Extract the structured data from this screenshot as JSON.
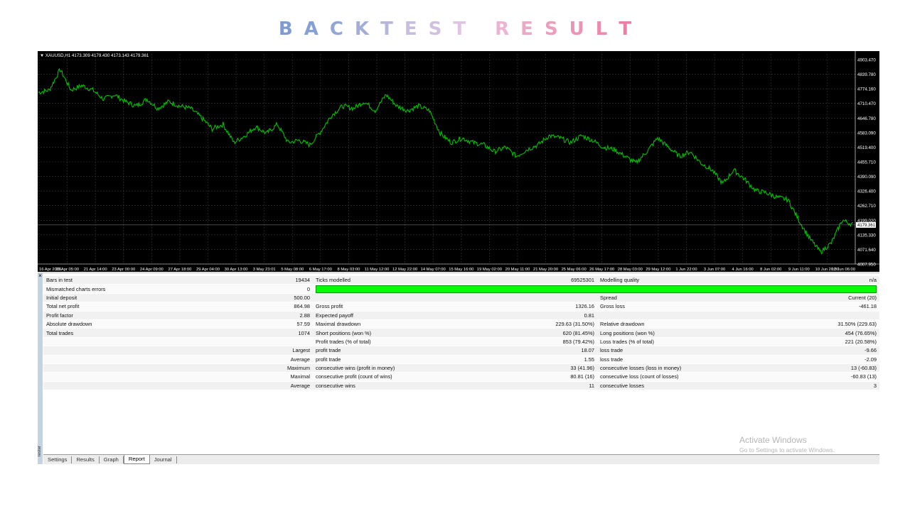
{
  "banner": {
    "letters": [
      {
        "ch": "B",
        "color": "#7f9bd1"
      },
      {
        "ch": "A",
        "color": "#86a0d3"
      },
      {
        "ch": "C",
        "color": "#93a7d6"
      },
      {
        "ch": "K",
        "color": "#a0aed9"
      },
      {
        "ch": "T",
        "color": "#b4b6dc"
      },
      {
        "ch": "E",
        "color": "#c6bddf"
      },
      {
        "ch": "S",
        "color": "#d2c0e0"
      },
      {
        "ch": "T",
        "color": "#e0c4e1"
      },
      {
        "ch": " ",
        "color": "#ffffff"
      },
      {
        "ch": "R",
        "color": "#eab4d2"
      },
      {
        "ch": "E",
        "color": "#eba9c7"
      },
      {
        "ch": "S",
        "color": "#ec9ebd"
      },
      {
        "ch": "U",
        "color": "#ed94b4"
      },
      {
        "ch": "L",
        "color": "#ee8aab"
      },
      {
        "ch": "T",
        "color": "#ef7fa2"
      }
    ]
  },
  "chart": {
    "header": "▼ XAUUSD,H1  4173.309 4179.430 4173.143 4179.361",
    "price_labels": [
      "4903.470",
      "4839.780",
      "4774.160",
      "4710.470",
      "4646.780",
      "4583.090",
      "4519.400",
      "4455.710",
      "4390.090",
      "4326.400",
      "4262.710",
      "4199.020",
      "4135.330",
      "4071.640",
      "4007.950"
    ],
    "current_price": "4179.361",
    "date_labels": [
      "16 Apr 2026",
      "20 Apr 05:00",
      "21 Apr 14:00",
      "23 Apr 00:00",
      "24 Apr 09:00",
      "27 Apr 18:00",
      "29 Apr 04:00",
      "30 Apr 13:00",
      "3 May 23:01",
      "5 May 08:00",
      "6 May 17:00",
      "8 May 03:00",
      "11 May 12:00",
      "12 May 22:00",
      "14 May 07:00",
      "15 May 16:00",
      "19 May 02:00",
      "20 May 11:00",
      "21 May 20:00",
      "25 May 06:00",
      "26 May 17:00",
      "28 May 03:00",
      "29 May 12:00",
      "1 Jun 22:00",
      "3 Jun 07:00",
      "4 Jun 16:00",
      "8 Jun 02:00",
      "9 Jun 11:00",
      "10 Jun 20:00",
      "12 Jun 06:00"
    ],
    "series_color": "#00c000",
    "chart_data": {
      "type": "line",
      "symbol": "XAUUSD,H1",
      "ylim": [
        4007.95,
        4903.47
      ],
      "values": [
        4760,
        4770,
        4860,
        4770,
        4790,
        4770,
        4730,
        4750,
        4720,
        4700,
        4730,
        4690,
        4720,
        4700,
        4690,
        4650,
        4600,
        4620,
        4540,
        4570,
        4610,
        4580,
        4620,
        4540,
        4550,
        4530,
        4590,
        4660,
        4700,
        4690,
        4720,
        4680,
        4750,
        4700,
        4680,
        4700,
        4680,
        4580,
        4540,
        4560,
        4540,
        4530,
        4500,
        4520,
        4480,
        4510,
        4530,
        4570,
        4560,
        4540,
        4570,
        4550,
        4520,
        4510,
        4480,
        4450,
        4500,
        4560,
        4520,
        4480,
        4500,
        4450,
        4420,
        4360,
        4420,
        4380,
        4330,
        4320,
        4300,
        4290,
        4200,
        4120,
        4060,
        4100,
        4200,
        4180
      ]
    }
  },
  "report": {
    "rows": [
      [
        "Bars in test",
        "19434",
        "Ticks modelled",
        "69525301",
        "Modelling quality",
        "n/a"
      ],
      [
        "Mismatched charts errors",
        "0",
        "__bar__",
        "",
        "",
        ""
      ],
      [
        "Initial deposit",
        "500.00",
        "",
        "",
        "Spread",
        "Current (20)"
      ],
      [
        "Total net profit",
        "864.98",
        "Gross profit",
        "1326.16",
        "Gross loss",
        "-461.18"
      ],
      [
        "Profit factor",
        "2.88",
        "Expected payoff",
        "0.81",
        "",
        ""
      ],
      [
        "Absolute drawdown",
        "57.59",
        "Maximal drawdown",
        "229.63 (31.50%)",
        "Relative drawdown",
        "31.50% (229.63)"
      ],
      [
        "Total trades",
        "1074",
        "Short positions (won %)",
        "620 (81.45%)",
        "Long positions (won %)",
        "454 (76.65%)"
      ],
      [
        "",
        "",
        "Profit trades (% of total)",
        "853 (79.42%)",
        "Loss trades (% of total)",
        "221 (20.58%)"
      ],
      [
        "",
        "Largest",
        "profit trade",
        "18.07",
        "loss trade",
        "-9.66"
      ],
      [
        "",
        "Average",
        "profit trade",
        "1.55",
        "loss trade",
        "-2.09"
      ],
      [
        "",
        "Maximum",
        "consecutive wins (profit in money)",
        "33 (41.96)",
        "consecutive losses (loss in money)",
        "13 (-60.83)"
      ],
      [
        "",
        "Maximal",
        "consecutive profit (count of wins)",
        "80.81 (16)",
        "consecutive loss (count of losses)",
        "-60.83 (13)"
      ],
      [
        "",
        "Average",
        "consecutive wins",
        "11",
        "consecutive losses",
        "3"
      ]
    ]
  },
  "tabs": [
    "Settings",
    "Results",
    "Graph",
    "Report",
    "Journal"
  ],
  "active_tab": "Report",
  "toolbox_label": "Tester",
  "watermark": {
    "title": "Activate Windows",
    "subtitle": "Go to Settings to activate Windows."
  }
}
